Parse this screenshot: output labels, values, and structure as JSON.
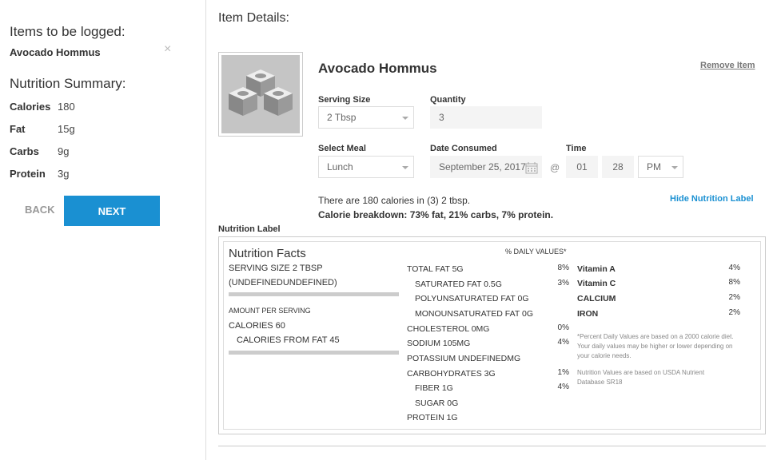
{
  "left": {
    "items_heading": "Items to be logged:",
    "item_name": "Avocado Hommus",
    "close_glyph": "×",
    "summary_heading": "Nutrition Summary:",
    "summary": [
      {
        "label": "Calories",
        "value": "180"
      },
      {
        "label": "Fat",
        "value": "15g"
      },
      {
        "label": "Carbs",
        "value": "9g"
      },
      {
        "label": "Protein",
        "value": "3g"
      }
    ],
    "back_label": "BACK",
    "next_label": "NEXT"
  },
  "details": {
    "title": "Item Details:",
    "food_name": "Avocado Hommus",
    "remove_label": "Remove Item",
    "serving_size_label": "Serving Size",
    "serving_size_value": "2 Tbsp",
    "quantity_label": "Quantity",
    "quantity_value": "3",
    "select_meal_label": "Select Meal",
    "meal_value": "Lunch",
    "date_label": "Date Consumed",
    "date_value": "September 25, 2017",
    "at_glyph": "@",
    "time_label": "Time",
    "hour_value": "01",
    "minute_value": "28",
    "ampm_value": "PM",
    "calorie_text": "There are 180 calories in (3) 2 tbsp.",
    "calorie_breakdown": "Calorie breakdown: 73% fat, 21% carbs, 7% protein.",
    "hide_label": "Hide Nutrition Label"
  },
  "nutrition": {
    "section_title": "Nutrition Label",
    "facts_title": "Nutrition Facts",
    "serving_size": "SERVING SIZE 2 TBSP",
    "serving_sub": "(UNDEFINEDUNDEFINED)",
    "amount_per": "AMOUNT PER SERVING",
    "calories": "CALORIES 60",
    "calories_fat": "CALORIES FROM FAT 45",
    "daily_values_header": "% DAILY VALUES*",
    "middle": [
      {
        "label": "TOTAL FAT 5G",
        "pct": "8%"
      },
      {
        "label": "SATURATED FAT 0.5G",
        "pct": "3%"
      },
      {
        "label": "POLYUNSATURATED FAT 0G",
        "pct": ""
      },
      {
        "label": "MONOUNSATURATED FAT 0G",
        "pct": ""
      },
      {
        "label": "CHOLESTEROL 0MG",
        "pct": "0%"
      },
      {
        "label": "SODIUM 105MG",
        "pct": "4%"
      },
      {
        "label": "POTASSIUM UNDEFINEDMG",
        "pct": ""
      },
      {
        "label": "CARBOHYDRATES 3G",
        "pct": "1%"
      },
      {
        "label": "FIBER 1G",
        "pct": "4%"
      },
      {
        "label": "SUGAR 0G",
        "pct": ""
      },
      {
        "label": "PROTEIN 1G",
        "pct": ""
      }
    ],
    "vitamins": [
      {
        "label": "Vitamin A",
        "pct": "4%"
      },
      {
        "label": "Vitamin C",
        "pct": "8%"
      },
      {
        "label": "CALCIUM",
        "pct": "2%"
      },
      {
        "label": "IRON",
        "pct": "2%"
      }
    ],
    "footnote": "*Percent Daily Values are based on a 2000 calorie diet. Your daily values may be higher or lower depending on your calorie needs.",
    "source_note": "Nutrition Values are based on USDA Nutrient Database SR18"
  }
}
